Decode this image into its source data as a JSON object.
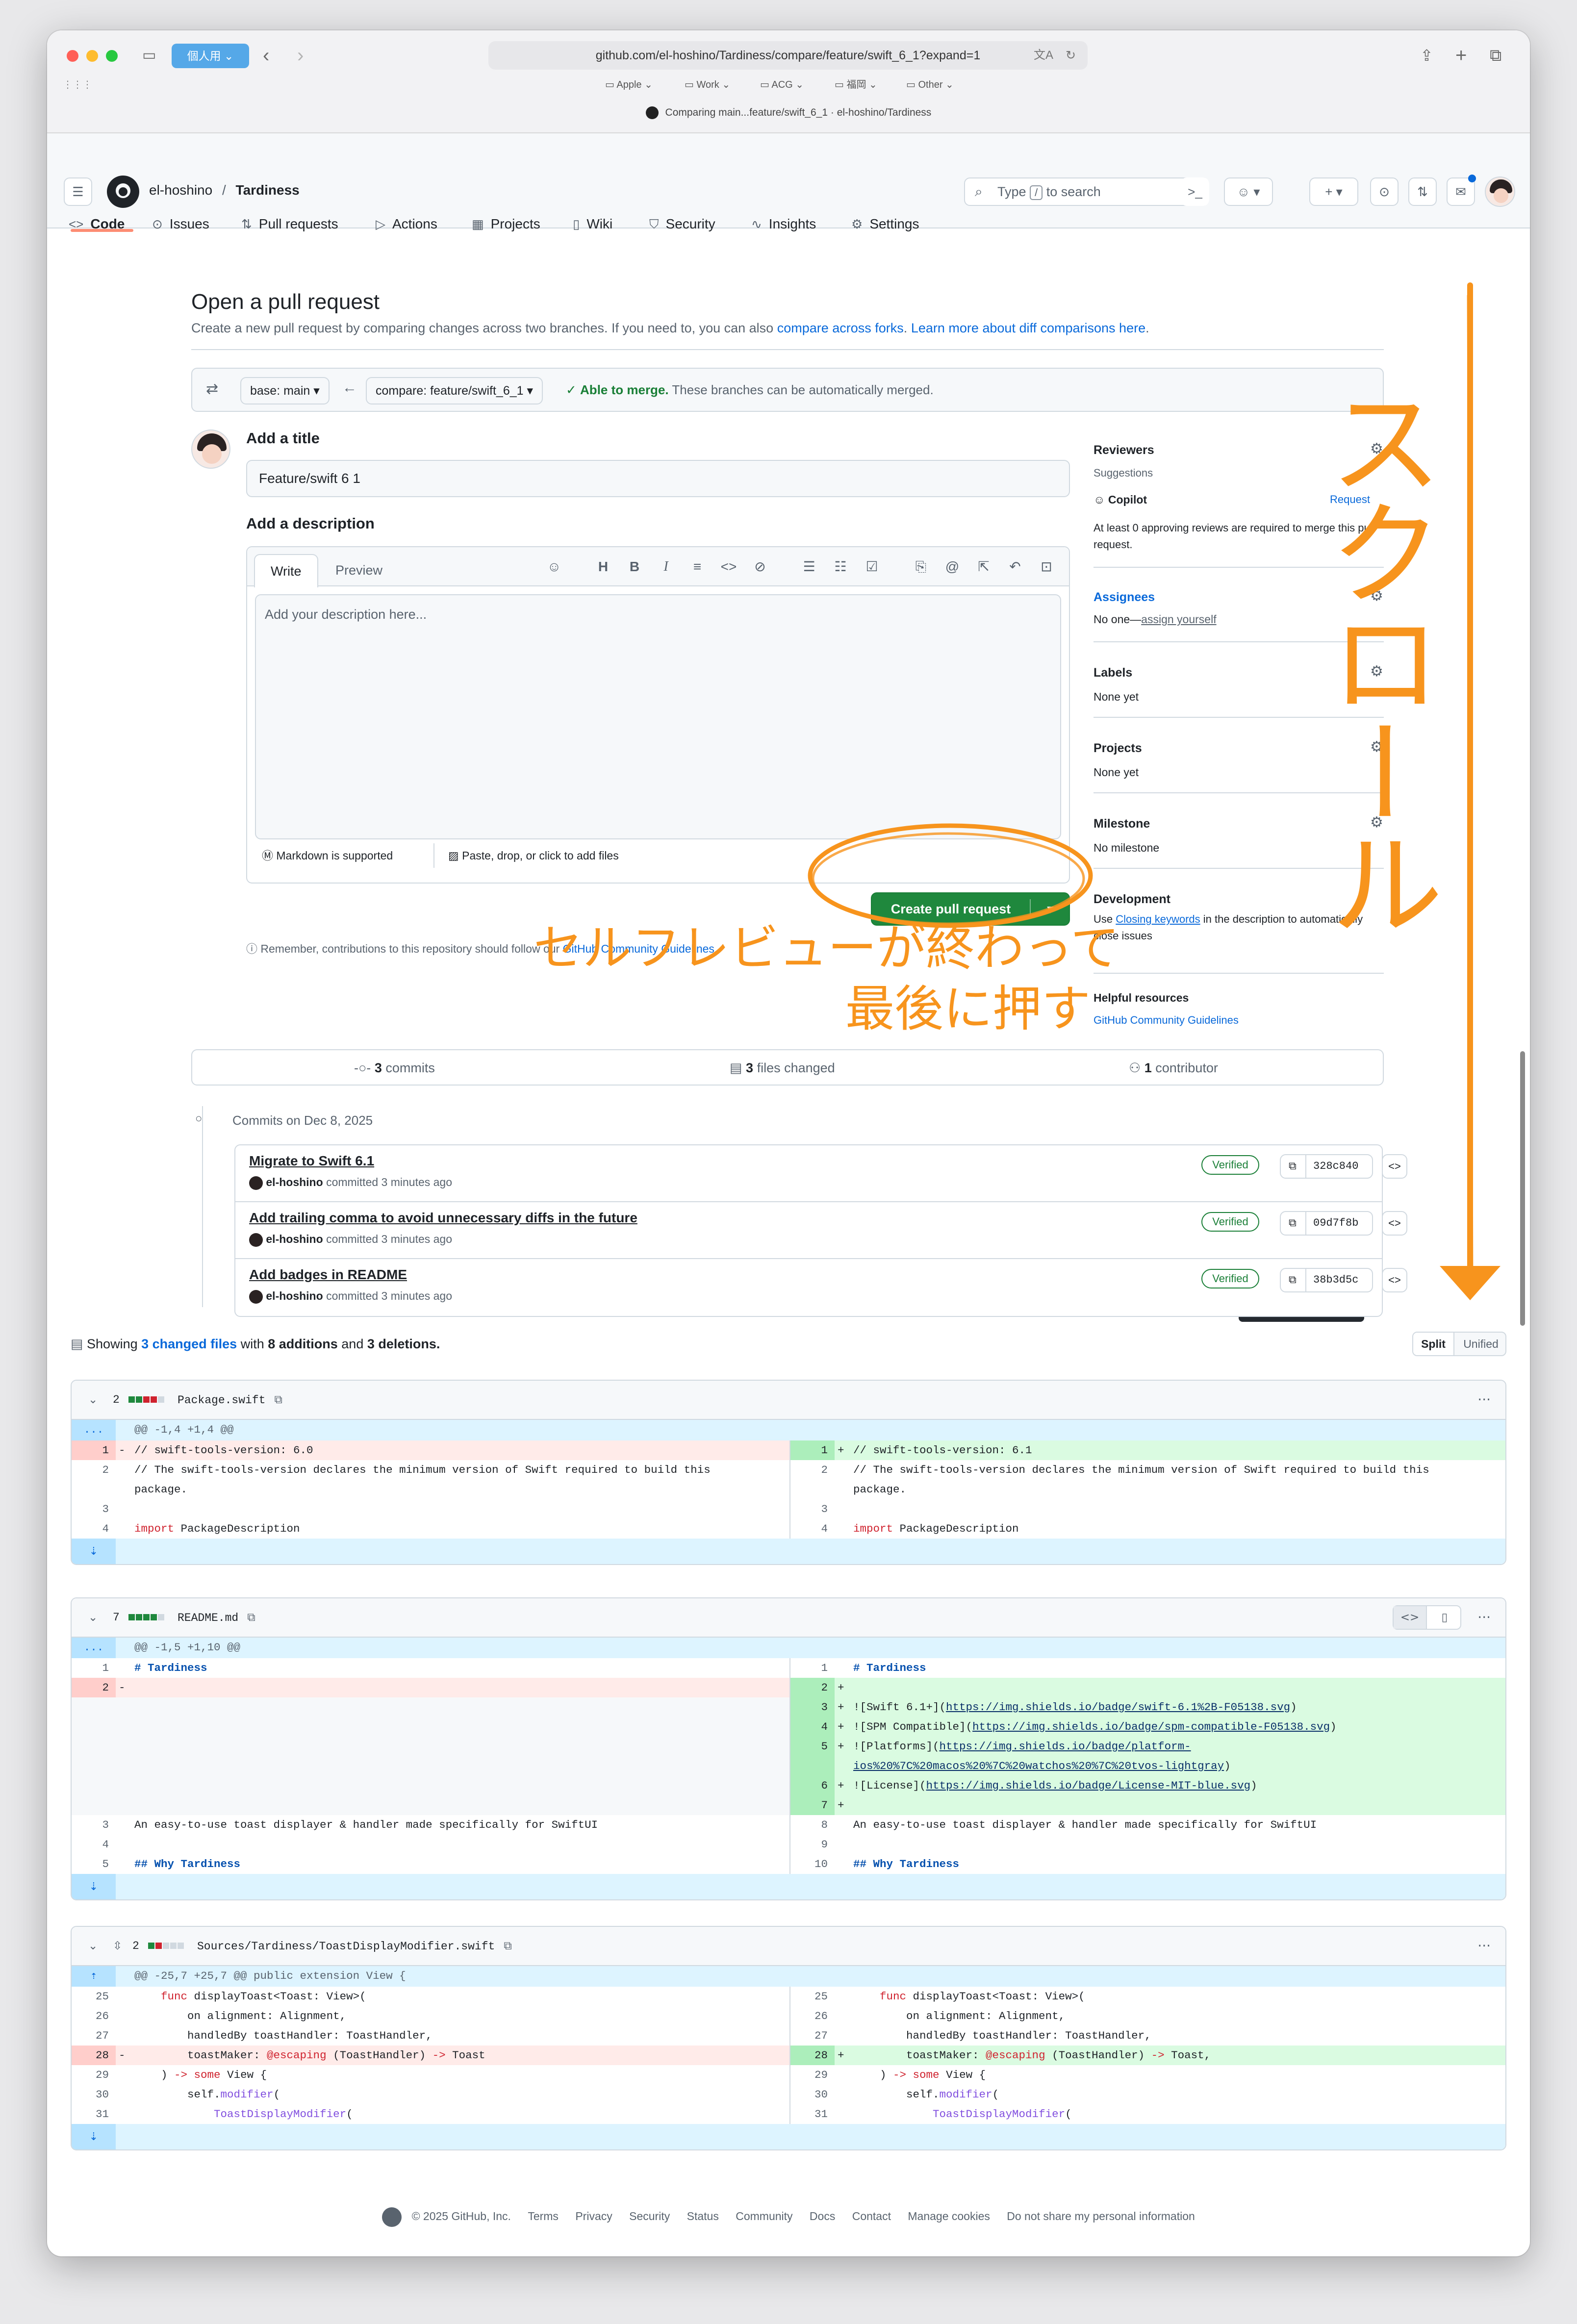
{
  "browser": {
    "profile": "個人用",
    "url": "github.com/el-hoshino/Tardiness/compare/feature/swift_6_1?expand=1",
    "favorites": [
      "Apple",
      "Work",
      "ACG",
      "福岡",
      "Other"
    ],
    "tab_title": "Comparing main...feature/swift_6_1 · el-hoshino/Tardiness"
  },
  "header": {
    "owner": "el-hoshino",
    "separator": "/",
    "repo": "Tardiness",
    "search_prefix": "Type",
    "search_key": "/",
    "search_suffix": "to search"
  },
  "repo_nav": [
    "Code",
    "Issues",
    "Pull requests",
    "Actions",
    "Projects",
    "Wiki",
    "Security",
    "Insights",
    "Settings"
  ],
  "page": {
    "title": "Open a pull request",
    "subtitle_start": "Create a new pull request by comparing changes across two branches. If you need to, you can also",
    "subtitle_link1": "compare across forks",
    "subtitle_link2": "Learn more about diff comparisons here"
  },
  "compare": {
    "base": "base: main",
    "head": "compare: feature/swift_6_1",
    "merge_ok": "Able to merge.",
    "merge_text": "These branches can be automatically merged."
  },
  "form": {
    "title_label": "Add a title",
    "title_value": "Feature/swift 6 1",
    "desc_label": "Add a description",
    "tab_write": "Write",
    "tab_preview": "Preview",
    "desc_placeholder": "Add your description here...",
    "markdown_note": "Markdown is supported",
    "paste_note": "Paste, drop, or click to add files",
    "create_button": "Create pull request",
    "reminder_start": "Remember, contributions to this repository should follow our",
    "reminder_link": "GitHub Community Guidelines"
  },
  "sidebar": {
    "reviewers": "Reviewers",
    "suggestions": "Suggestions",
    "copilot": "Copilot",
    "request": "Request",
    "approving": "At least 0 approving reviews are required to merge this pull request.",
    "assignees": "Assignees",
    "no_one": "No one—",
    "assign_yourself": "assign yourself",
    "labels": "Labels",
    "labels_value": "None yet",
    "projects": "Projects",
    "projects_value": "None yet",
    "milestone": "Milestone",
    "milestone_value": "No milestone",
    "development": "Development",
    "dev_text_pre": "Use",
    "dev_link": "Closing keywords",
    "dev_text_post": "in the description to automatically close issues",
    "helpful": "Helpful resources",
    "helpful_link": "GitHub Community Guidelines"
  },
  "stats": {
    "commits_n": "3",
    "commits": "commits",
    "files_n": "3",
    "files": "files changed",
    "contributors_n": "1",
    "contributors": "contributor"
  },
  "commits": {
    "date": "Commits on Dec 8, 2025",
    "items": [
      {
        "title": "Migrate to Swift 6.1",
        "author": "el-hoshino",
        "meta": "committed 3 minutes ago",
        "badge": "Verified",
        "sha": "328c840"
      },
      {
        "title": "Add trailing comma to avoid unnecessary diffs in the future",
        "author": "el-hoshino",
        "meta": "committed 3 minutes ago",
        "badge": "Verified",
        "sha": "09d7f8b"
      },
      {
        "title": "Add badges in README",
        "author": "el-hoshino",
        "meta": "committed 3 minutes ago",
        "badge": "Verified",
        "sha": "38b3d5c"
      }
    ]
  },
  "diffsummary": {
    "showing": "Showing",
    "changed": "3 changed files",
    "with": "with",
    "additions": "8 additions",
    "and": "and",
    "deletions": "3 deletions.",
    "split": "Split",
    "unified": "Unified"
  },
  "files": [
    {
      "count": "2",
      "name": "Package.swift",
      "hunk": "@@ -1,4 +1,4 @@",
      "left": [
        {
          "n": "1",
          "m": "-",
          "t": "// swift-tools-version: 6.0"
        },
        {
          "n": "2",
          "m": "",
          "t": "// The swift-tools-version declares the minimum version of Swift required to build this"
        },
        {
          "n": "",
          "m": "",
          "t": "package."
        },
        {
          "n": "3",
          "m": "",
          "t": ""
        },
        {
          "n": "4",
          "m": "",
          "k": "import",
          "t": " PackageDescription"
        }
      ],
      "right": [
        {
          "n": "1",
          "m": "+",
          "t": "// swift-tools-version: 6.1"
        },
        {
          "n": "2",
          "m": "",
          "t": "// The swift-tools-version declares the minimum version of Swift required to build this"
        },
        {
          "n": "",
          "m": "",
          "t": "package."
        },
        {
          "n": "3",
          "m": "",
          "t": ""
        },
        {
          "n": "4",
          "m": "",
          "k": "import",
          "t": " PackageDescription"
        }
      ]
    },
    {
      "count": "7",
      "name": "README.md",
      "hunk": "@@ -1,5 +1,10 @@",
      "left": [
        {
          "n": "1",
          "t": "# Tardiness"
        },
        {
          "n": "2",
          "m": "-",
          "t": ""
        },
        {
          "n": "3",
          "t": "An easy-to-use toast displayer & handler made specifically for SwiftUI"
        },
        {
          "n": "4",
          "t": ""
        },
        {
          "n": "5",
          "t": "## Why Tardiness"
        }
      ],
      "right": [
        {
          "n": "1",
          "t": "# Tardiness"
        },
        {
          "n": "2",
          "m": "+",
          "t": ""
        },
        {
          "n": "3",
          "m": "+",
          "t": "![Swift 6.1+](",
          "u": "https://img.shields.io/badge/swift-6.1%2B-F05138.svg",
          "e": ")"
        },
        {
          "n": "4",
          "m": "+",
          "t": "![SPM Compatible](",
          "u": "https://img.shields.io/badge/spm-compatible-F05138.svg",
          "e": ")"
        },
        {
          "n": "5",
          "m": "+",
          "t": "![Platforms](",
          "u": "https://img.shields.io/badge/platform-",
          "e": ""
        },
        {
          "n": "",
          "m": "",
          "t": "",
          "u": "ios%20%7C%20macos%20%7C%20watchos%20%7C%20tvos-lightgray",
          "e": ")"
        },
        {
          "n": "6",
          "m": "+",
          "t": "![License](",
          "u": "https://img.shields.io/badge/License-MIT-blue.svg",
          "e": ")"
        },
        {
          "n": "7",
          "m": "+",
          "t": ""
        },
        {
          "n": "8",
          "t": "An easy-to-use toast displayer & handler made specifically for SwiftUI"
        },
        {
          "n": "9",
          "t": ""
        },
        {
          "n": "10",
          "t": "## Why Tardiness"
        }
      ]
    },
    {
      "count": "2",
      "name": "Sources/Tardiness/ToastDisplayModifier.swift",
      "hunk": "@@ -25,7 +25,7 @@ public extension View {",
      "left": [
        {
          "n": "25",
          "t": "    func displayToast<Toast: View>("
        },
        {
          "n": "26",
          "t": "        on alignment: Alignment,"
        },
        {
          "n": "27",
          "t": "        handledBy toastHandler: ToastHandler,"
        },
        {
          "n": "28",
          "m": "-",
          "t": "        toastMaker: @escaping (ToastHandler) -> Toast"
        },
        {
          "n": "29",
          "t": "    ) -> some View {"
        },
        {
          "n": "30",
          "t": "        self.modifier("
        },
        {
          "n": "31",
          "t": "            ToastDisplayModifier("
        }
      ],
      "right": [
        {
          "n": "25",
          "t": "    func displayToast<Toast: View>("
        },
        {
          "n": "26",
          "t": "        on alignment: Alignment,"
        },
        {
          "n": "27",
          "t": "        handledBy toastHandler: ToastHandler,"
        },
        {
          "n": "28",
          "m": "+",
          "t": "        toastMaker: @escaping (ToastHandler) -> Toast,"
        },
        {
          "n": "29",
          "t": "    ) -> some View {"
        },
        {
          "n": "30",
          "t": "        self.modifier("
        },
        {
          "n": "31",
          "t": "            ToastDisplayModifier("
        }
      ]
    }
  ],
  "footer": {
    "copyright": "© 2025 GitHub, Inc.",
    "links": [
      "Terms",
      "Privacy",
      "Security",
      "Status",
      "Community",
      "Docs",
      "Contact",
      "Manage cookies",
      "Do not share my personal information"
    ]
  },
  "annotations": {
    "scroll": "スクロール",
    "self_review_1": "セルフレビューが終わって",
    "self_review_2": "最後に押す"
  },
  "colors": {
    "accent": "#0969da",
    "success": "#1f883d",
    "annotation": "#f7941d"
  }
}
